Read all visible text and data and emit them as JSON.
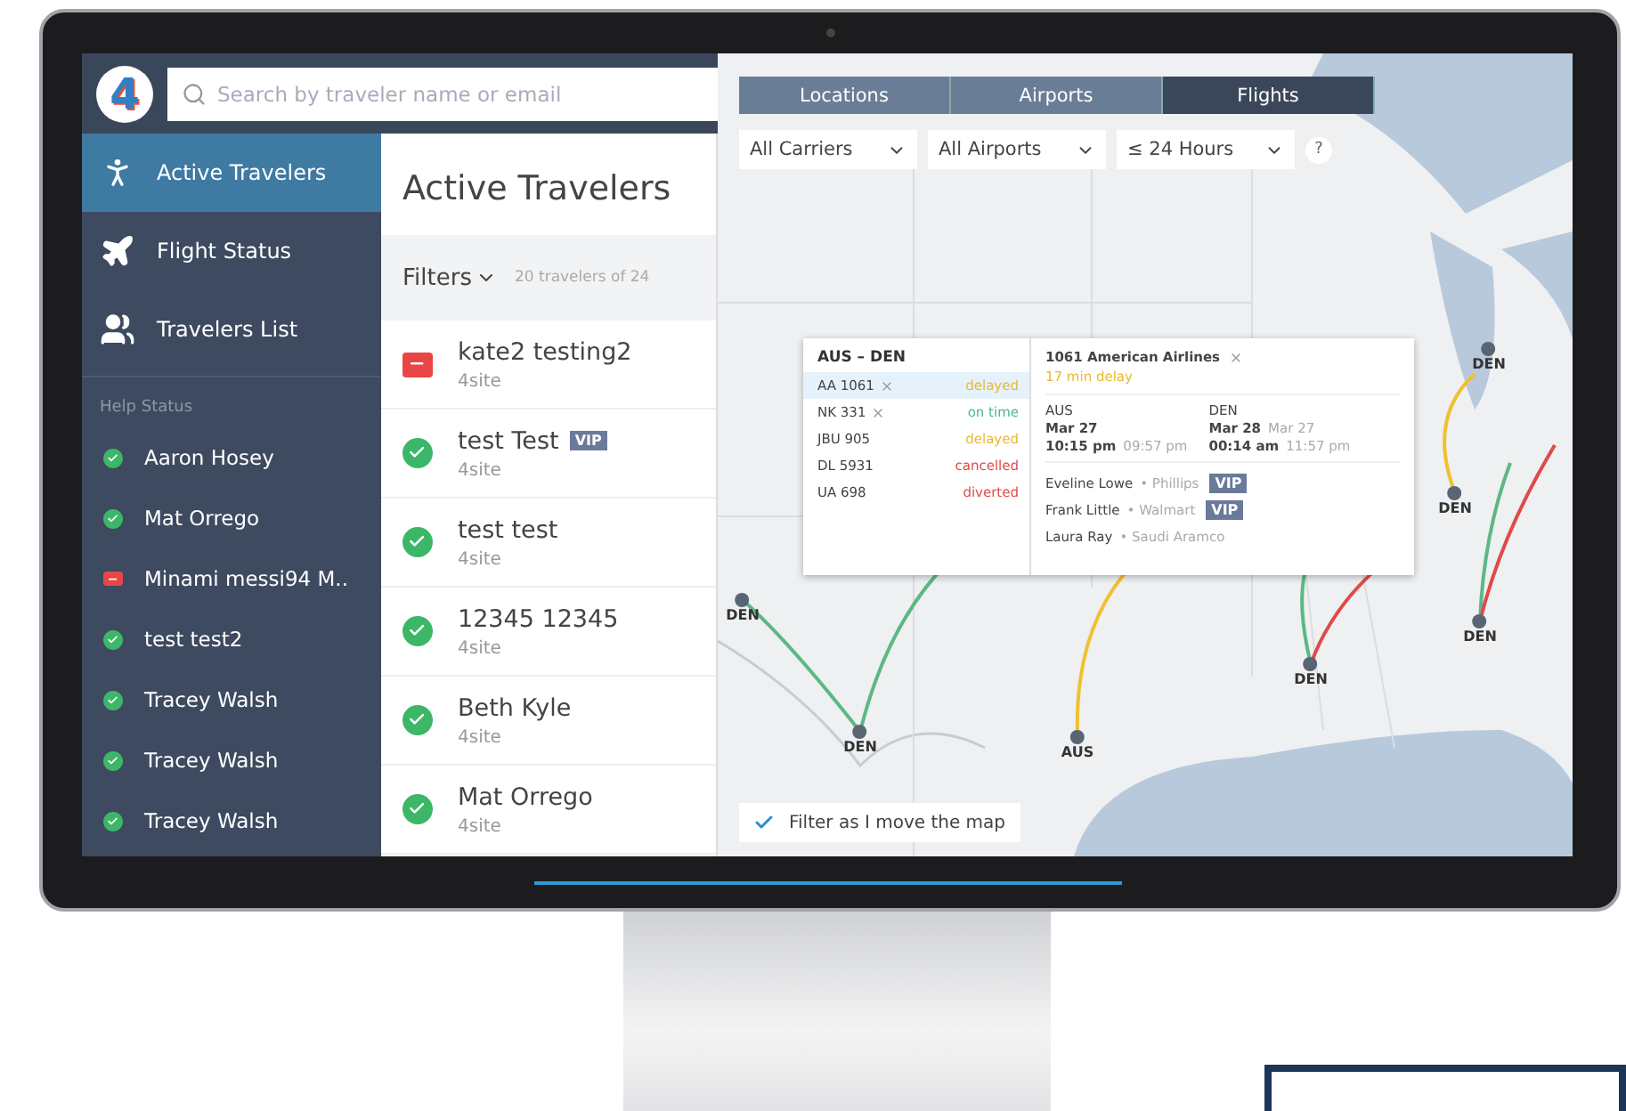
{
  "logo": "4",
  "search": {
    "placeholder": "Search by traveler name or email"
  },
  "nav": [
    {
      "label": "Active Travelers",
      "kind": "walk",
      "selected": true
    },
    {
      "label": "Flight Status",
      "kind": "plane",
      "selected": false
    },
    {
      "label": "Travelers List",
      "kind": "users",
      "selected": false
    }
  ],
  "help_status": {
    "title": "Help Status",
    "items": [
      {
        "name": "Aaron Hosey",
        "kind": "ok"
      },
      {
        "name": "Mat Orrego",
        "kind": "ok"
      },
      {
        "name": "Minami messi94 M..",
        "kind": "alert"
      },
      {
        "name": "test test2",
        "kind": "ok"
      },
      {
        "name": "Tracey Walsh",
        "kind": "ok"
      },
      {
        "name": "Tracey Walsh",
        "kind": "ok"
      },
      {
        "name": "Tracey Walsh",
        "kind": "ok"
      }
    ]
  },
  "list": {
    "title": "Active Travelers",
    "filters": "Filters",
    "count": "20 travelers of 24",
    "travelers": [
      {
        "name": "kate2 testing2",
        "site": "4site",
        "kind": "alert"
      },
      {
        "name": "test Test",
        "site": "4site",
        "kind": "ok",
        "badge": "VIP"
      },
      {
        "name": "test test",
        "site": "4site",
        "kind": "ok"
      },
      {
        "name": "12345 12345",
        "site": "4site",
        "kind": "ok"
      },
      {
        "name": "Beth Kyle",
        "site": "4site",
        "kind": "ok"
      },
      {
        "name": "Mat Orrego",
        "site": "4site",
        "kind": "ok"
      }
    ]
  },
  "map_tabs": [
    {
      "label": "Locations",
      "selected": false
    },
    {
      "label": "Airports",
      "selected": false
    },
    {
      "label": "Flights",
      "selected": true
    }
  ],
  "map_filters": [
    {
      "value": "All Carriers"
    },
    {
      "value": "All Airports"
    },
    {
      "value": "≤ 24 Hours"
    }
  ],
  "help": "?",
  "markers": [
    {
      "code": "DEN"
    },
    {
      "code": "DEN"
    },
    {
      "code": "AUS"
    },
    {
      "code": "DEN"
    },
    {
      "code": "DEN"
    },
    {
      "code": "DEN"
    },
    {
      "code": "DEN"
    }
  ],
  "arcs": [
    {
      "color": "#5cb885"
    },
    {
      "color": "#5cb885"
    },
    {
      "color": "#f0c030"
    },
    {
      "color": "#5cb885"
    },
    {
      "color": "#e04a4a"
    },
    {
      "color": "#f0c030"
    },
    {
      "color": "#5cb885"
    },
    {
      "color": "#e04a4a"
    }
  ],
  "popup": {
    "route": "AUS – DEN",
    "flights": [
      {
        "code": "AA 1061",
        "closable": true,
        "status": "delayed",
        "color": "#e8b830",
        "selected": true
      },
      {
        "code": "NK 331",
        "closable": true,
        "status": "on time",
        "color": "#4cb884",
        "selected": false
      },
      {
        "code": "JBU 905",
        "closable": false,
        "status": "delayed",
        "color": "#e8b830",
        "selected": false
      },
      {
        "code": "DL 5931",
        "closable": false,
        "status": "cancelled",
        "color": "#e04a4a",
        "selected": false
      },
      {
        "code": "UA 698",
        "closable": false,
        "status": "diverted",
        "color": "#e04a4a",
        "selected": false
      }
    ],
    "detail": {
      "title": "1061 American Airlines",
      "delay": "17 min delay",
      "legs": [
        {
          "airport": "AUS",
          "date": "Mar 27",
          "time": "10:15 pm",
          "scheduled": "09:57 pm"
        },
        {
          "airport": "DEN",
          "date": "Mar 28",
          "time": "00:14 am",
          "scheduled_date": "Mar 27",
          "scheduled": "11:57 pm"
        }
      ],
      "passengers": [
        {
          "name": "Eveline Lowe",
          "company": "• Phillips",
          "badge": "VIP"
        },
        {
          "name": "Frank Little",
          "company": "• Walmart",
          "badge": "VIP"
        },
        {
          "name": "Laura Ray",
          "company": "• Saudi Aramco"
        }
      ]
    }
  },
  "filter_toggle": {
    "label": "Filter as I move the map",
    "checked": true
  }
}
